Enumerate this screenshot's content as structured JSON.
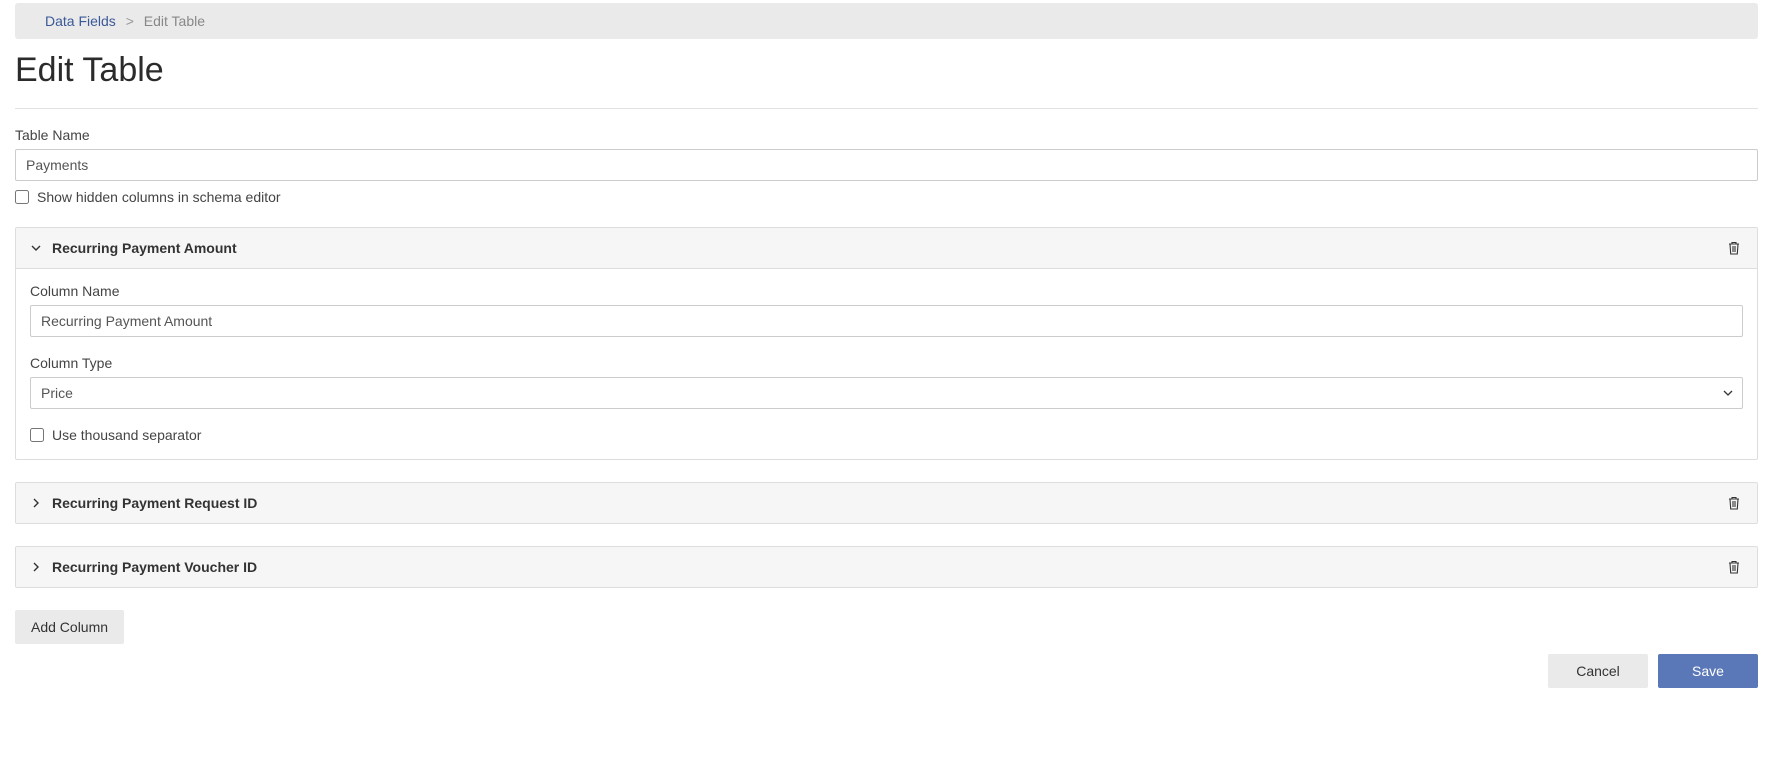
{
  "breadcrumb": {
    "root": "Data Fields",
    "sep": ">",
    "current": "Edit Table"
  },
  "page_title": "Edit Table",
  "table_name": {
    "label": "Table Name",
    "value": "Payments"
  },
  "show_hidden": {
    "label": "Show hidden columns in schema editor",
    "checked": false
  },
  "columns": [
    {
      "title": "Recurring Payment Amount",
      "expanded": true,
      "column_name": {
        "label": "Column Name",
        "value": "Recurring Payment Amount"
      },
      "column_type": {
        "label": "Column Type",
        "value": "Price"
      },
      "thousand_sep": {
        "label": "Use thousand separator",
        "checked": false
      }
    },
    {
      "title": "Recurring Payment Request ID",
      "expanded": false
    },
    {
      "title": "Recurring Payment Voucher ID",
      "expanded": false
    }
  ],
  "add_column_label": "Add Column",
  "footer": {
    "cancel": "Cancel",
    "save": "Save"
  }
}
